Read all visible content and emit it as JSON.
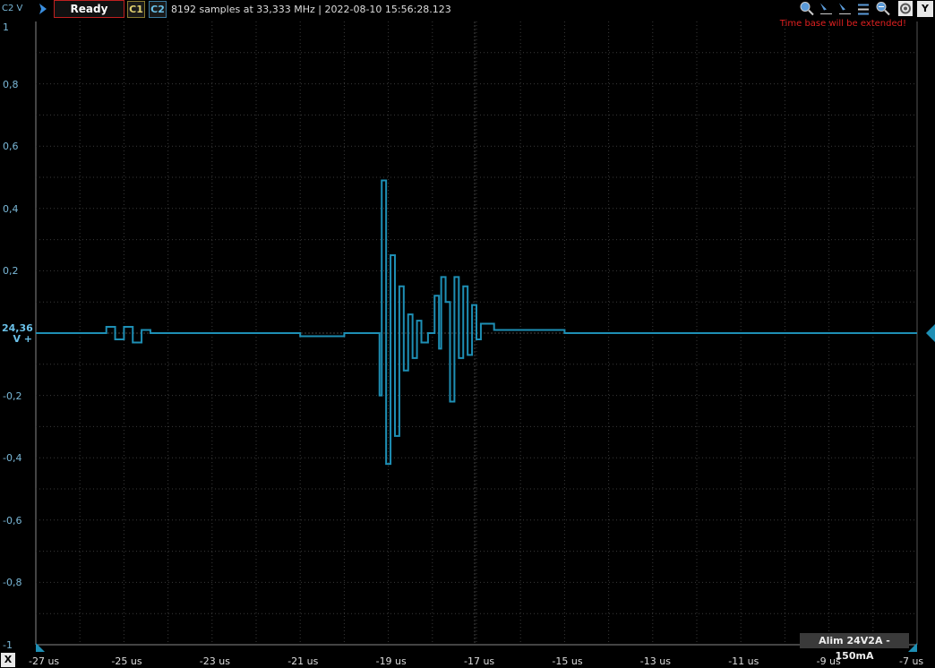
{
  "toolbar": {
    "channel_axis_label": "C2 V",
    "status": "Ready",
    "channel1": "C1",
    "channel2": "C2",
    "acquisition_info": "8192 samples at 33,333 MHz | 2022-08-10 15:56:28.123",
    "icons": [
      "zoom-in-icon",
      "cursor-tool-icon",
      "cursor-tool-icon",
      "cursor-tool-icon",
      "zoom-out-icon",
      "settings-icon"
    ],
    "y_toggle": "Y",
    "warning": "Time base will be extended!"
  },
  "axes": {
    "y_ticks": [
      "1",
      "0,8",
      "0,6",
      "0,4",
      "0,2",
      "-0,2",
      "-0,4",
      "-0,6",
      "-0,8",
      "-1"
    ],
    "x_ticks": [
      "-27 us",
      "-25 us",
      "-23 us",
      "-21 us",
      "-19 us",
      "-17 us",
      "-15 us",
      "-13 us",
      "-11 us",
      "-9 us",
      "-7 us"
    ],
    "x_toggle": "X",
    "offset_value": "24,36",
    "offset_unit": "V +"
  },
  "trace": {
    "color": "#1e8fb5",
    "baseline": 0.0,
    "samples": [
      [
        -27.0,
        0.0
      ],
      [
        -25.8,
        0.0
      ],
      [
        -25.4,
        0.02
      ],
      [
        -25.2,
        -0.02
      ],
      [
        -25.0,
        0.02
      ],
      [
        -24.8,
        -0.03
      ],
      [
        -24.6,
        0.01
      ],
      [
        -24.4,
        0.0
      ],
      [
        -22.0,
        0.0
      ],
      [
        -21.0,
        -0.01
      ],
      [
        -20.0,
        0.0
      ],
      [
        -19.3,
        0.0
      ],
      [
        -19.2,
        -0.2
      ],
      [
        -19.15,
        0.49
      ],
      [
        -19.05,
        -0.42
      ],
      [
        -18.95,
        0.25
      ],
      [
        -18.85,
        -0.33
      ],
      [
        -18.75,
        0.15
      ],
      [
        -18.65,
        -0.12
      ],
      [
        -18.55,
        0.06
      ],
      [
        -18.45,
        -0.08
      ],
      [
        -18.35,
        0.04
      ],
      [
        -18.25,
        -0.03
      ],
      [
        -18.1,
        0.0
      ],
      [
        -17.95,
        0.12
      ],
      [
        -17.85,
        -0.05
      ],
      [
        -17.8,
        0.18
      ],
      [
        -17.7,
        0.1
      ],
      [
        -17.6,
        -0.22
      ],
      [
        -17.5,
        0.18
      ],
      [
        -17.4,
        -0.08
      ],
      [
        -17.3,
        0.15
      ],
      [
        -17.2,
        -0.07
      ],
      [
        -17.1,
        0.09
      ],
      [
        -17.0,
        -0.02
      ],
      [
        -16.9,
        0.03
      ],
      [
        -16.6,
        0.01
      ],
      [
        -15.0,
        0.0
      ],
      [
        -13.0,
        0.0
      ],
      [
        -11.0,
        0.0
      ],
      [
        -9.0,
        0.0
      ],
      [
        -7.0,
        0.0
      ]
    ]
  },
  "footer_label": "Alim 24V2A - 150mA"
}
